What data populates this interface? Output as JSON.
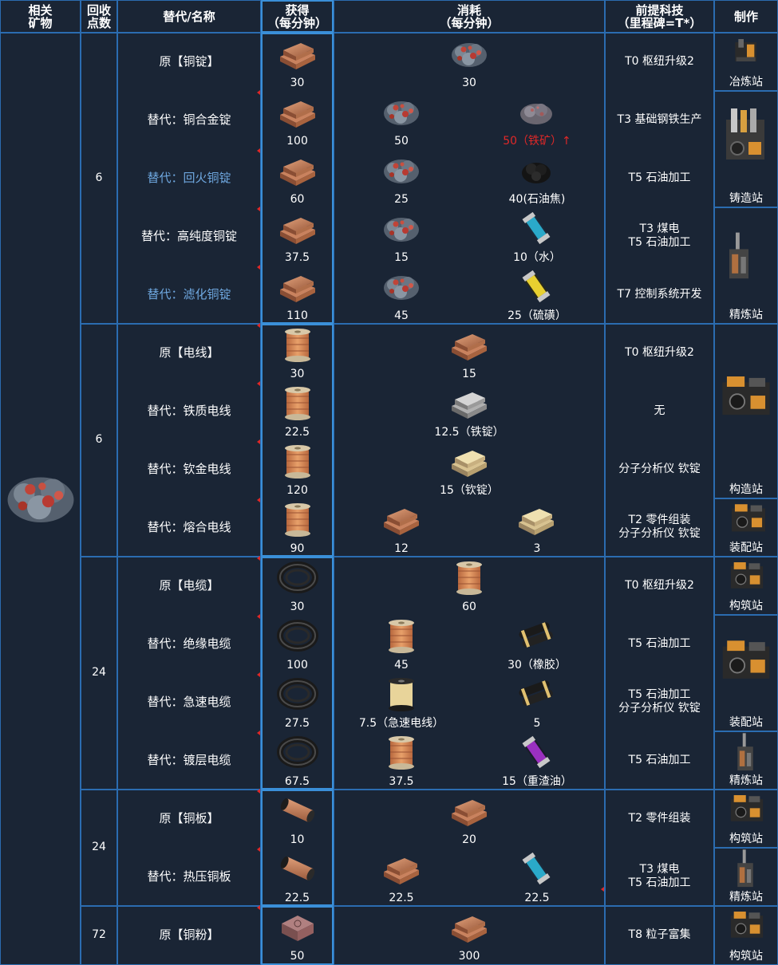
{
  "headers": {
    "mineral": "相关\n矿物",
    "points": "回收\n点数",
    "name": "替代/名称",
    "gain": "获得\n（每分钟）",
    "cost": "消耗\n（每分钟）",
    "tech": "前提科技\n（里程碑=T*）",
    "make": "制作"
  },
  "colors": {
    "bg": "#1a2535",
    "border": "#2b6cb0",
    "blue_text": "#6fa8e0",
    "red_text": "#e02828"
  },
  "groups": [
    {
      "points": "6"
    },
    {
      "points": "6"
    },
    {
      "points": "24"
    },
    {
      "points": "24"
    },
    {
      "points": "72"
    }
  ],
  "rows": [
    {
      "name": "原【铜锭】",
      "gain": "30",
      "cost1": "30",
      "cost2": "",
      "tech": "T0 枢纽升级2"
    },
    {
      "name": "替代：铜合金锭",
      "gain": "100",
      "cost1": "50",
      "cost2": "50（铁矿）↑",
      "tech": "T3 基础钢铁生产"
    },
    {
      "name": "替代：回火铜锭",
      "gain": "60",
      "cost1": "25",
      "cost2": "40(石油焦)",
      "tech": "T5 石油加工"
    },
    {
      "name": "替代：高纯度铜锭",
      "gain": "37.5",
      "cost1": "15",
      "cost2": "10（水）",
      "tech": "T3 煤电\nT5 石油加工"
    },
    {
      "name": "替代：滤化铜锭",
      "gain": "110",
      "cost1": "45",
      "cost2": "25（硫磺）",
      "tech": "T7 控制系统开发"
    },
    {
      "name": "原【电线】",
      "gain": "30",
      "cost1": "15",
      "cost2": "",
      "tech": "T0 枢纽升级2"
    },
    {
      "name": "替代：铁质电线",
      "gain": "22.5",
      "cost1": "12.5（铁锭）",
      "cost2": "",
      "tech": "无"
    },
    {
      "name": "替代：钦金电线",
      "gain": "120",
      "cost1": "15（钦锭）",
      "cost2": "",
      "tech": "分子分析仪 钦锭"
    },
    {
      "name": "替代：熔合电线",
      "gain": "90",
      "cost1": "12",
      "cost2": "3",
      "tech": "T2 零件组装\n分子分析仪 钦锭"
    },
    {
      "name": "原【电缆】",
      "gain": "30",
      "cost1": "60",
      "cost2": "",
      "tech": "T0 枢纽升级2"
    },
    {
      "name": "替代：绝缘电缆",
      "gain": "100",
      "cost1": "45",
      "cost2": "30（橡胶）",
      "tech": "T5 石油加工"
    },
    {
      "name": "替代：急速电缆",
      "gain": "27.5",
      "cost1": "7.5（急速电线）",
      "cost2": "5",
      "tech": "T5 石油加工\n分子分析仪 钦锭"
    },
    {
      "name": "替代：镀层电缆",
      "gain": "67.5",
      "cost1": "37.5",
      "cost2": "15（重渣油）",
      "tech": "T5 石油加工"
    },
    {
      "name": "原【铜板】",
      "gain": "10",
      "cost1": "20",
      "cost2": "",
      "tech": "T2 零件组装"
    },
    {
      "name": "替代：热压铜板",
      "gain": "22.5",
      "cost1": "22.5",
      "cost2": "22.5",
      "tech": "T3 煤电\nT5 石油加工"
    },
    {
      "name": "原【铜粉】",
      "gain": "50",
      "cost1": "300",
      "cost2": "",
      "tech": "T8 粒子富集"
    }
  ],
  "stations": [
    {
      "label": "冶炼站",
      "icon": "smelter-icon"
    },
    {
      "label": "铸造站",
      "icon": "foundry-icon"
    },
    {
      "label": "精炼站",
      "icon": "refinery-icon"
    },
    {
      "label": "构造站",
      "icon": "constructor-icon"
    },
    {
      "label": "装配站",
      "icon": "assembler-icon"
    },
    {
      "label": "构筑站",
      "icon": "constructor-icon"
    },
    {
      "label": "装配站",
      "icon": "assembler-icon"
    },
    {
      "label": "精炼站",
      "icon": "refinery-icon"
    },
    {
      "label": "构筑站",
      "icon": "constructor-icon"
    },
    {
      "label": "精炼站",
      "icon": "refinery-icon"
    },
    {
      "label": "构筑站",
      "icon": "constructor-icon"
    }
  ]
}
